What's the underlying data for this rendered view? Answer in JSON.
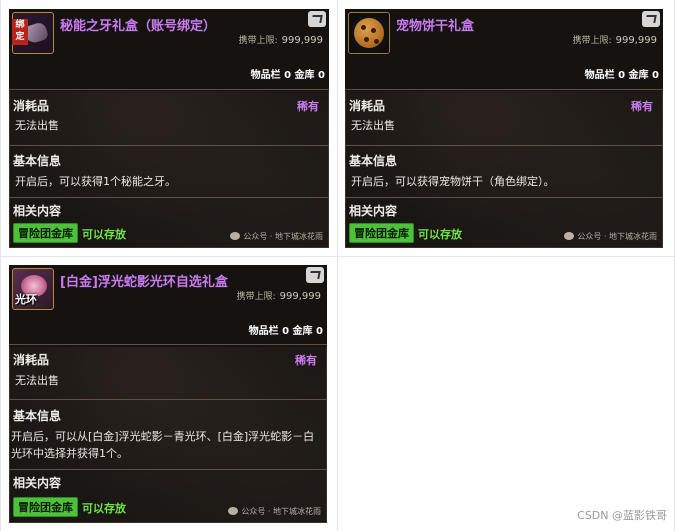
{
  "items": [
    {
      "title": "秘能之牙礼盒（账号绑定）",
      "icon": "fang-gem-icon",
      "limit_label": "携带上限:",
      "limit_value": "999,999",
      "slot_text": "物品栏 0 金库 0",
      "category": "消耗品",
      "rarity": "稀有",
      "sell_text": "无法出售",
      "info_title": "基本信息",
      "description": "开启后，可以获得1个秘能之牙。",
      "related_title": "相关内容",
      "warehouse_label": "冒险团金库",
      "storable_text": "可以存放",
      "watermark": "公众号 · 地下城冰花雨"
    },
    {
      "title": "宠物饼干礼盒",
      "icon": "cookie-icon",
      "limit_label": "携带上限:",
      "limit_value": "999,999",
      "slot_text": "物品栏 0 金库 0",
      "category": "消耗品",
      "rarity": "稀有",
      "sell_text": "无法出售",
      "info_title": "基本信息",
      "description": "开启后，可以获得宠物饼干（角色绑定）。",
      "related_title": "相关内容",
      "warehouse_label": "冒险团金库",
      "storable_text": "可以存放",
      "watermark": "公众号 · 地下城冰花雨"
    },
    {
      "title": "[白金]浮光蛇影光环自选礼盒",
      "icon": "aura-ring-icon",
      "icon_label": "光环",
      "limit_label": "携带上限:",
      "limit_value": "999,999",
      "slot_text": "物品栏 0 金库 0",
      "category": "消耗品",
      "rarity": "稀有",
      "sell_text": "无法出售",
      "info_title": "基本信息",
      "description": "开启后，可以从[白金]浮光蛇影－青光环、[白金]浮光蛇影－白光环中选择并获得1个。",
      "related_title": "相关内容",
      "warehouse_label": "冒险团金库",
      "storable_text": "可以存放",
      "watermark": "公众号 · 地下城冰花雨"
    }
  ],
  "footer": {
    "credit": "CSDN @蓝影铁哥"
  },
  "colors": {
    "title": "#c97bf2",
    "storable": "#6fe44a",
    "warehouse_button": "#4ec13a"
  }
}
